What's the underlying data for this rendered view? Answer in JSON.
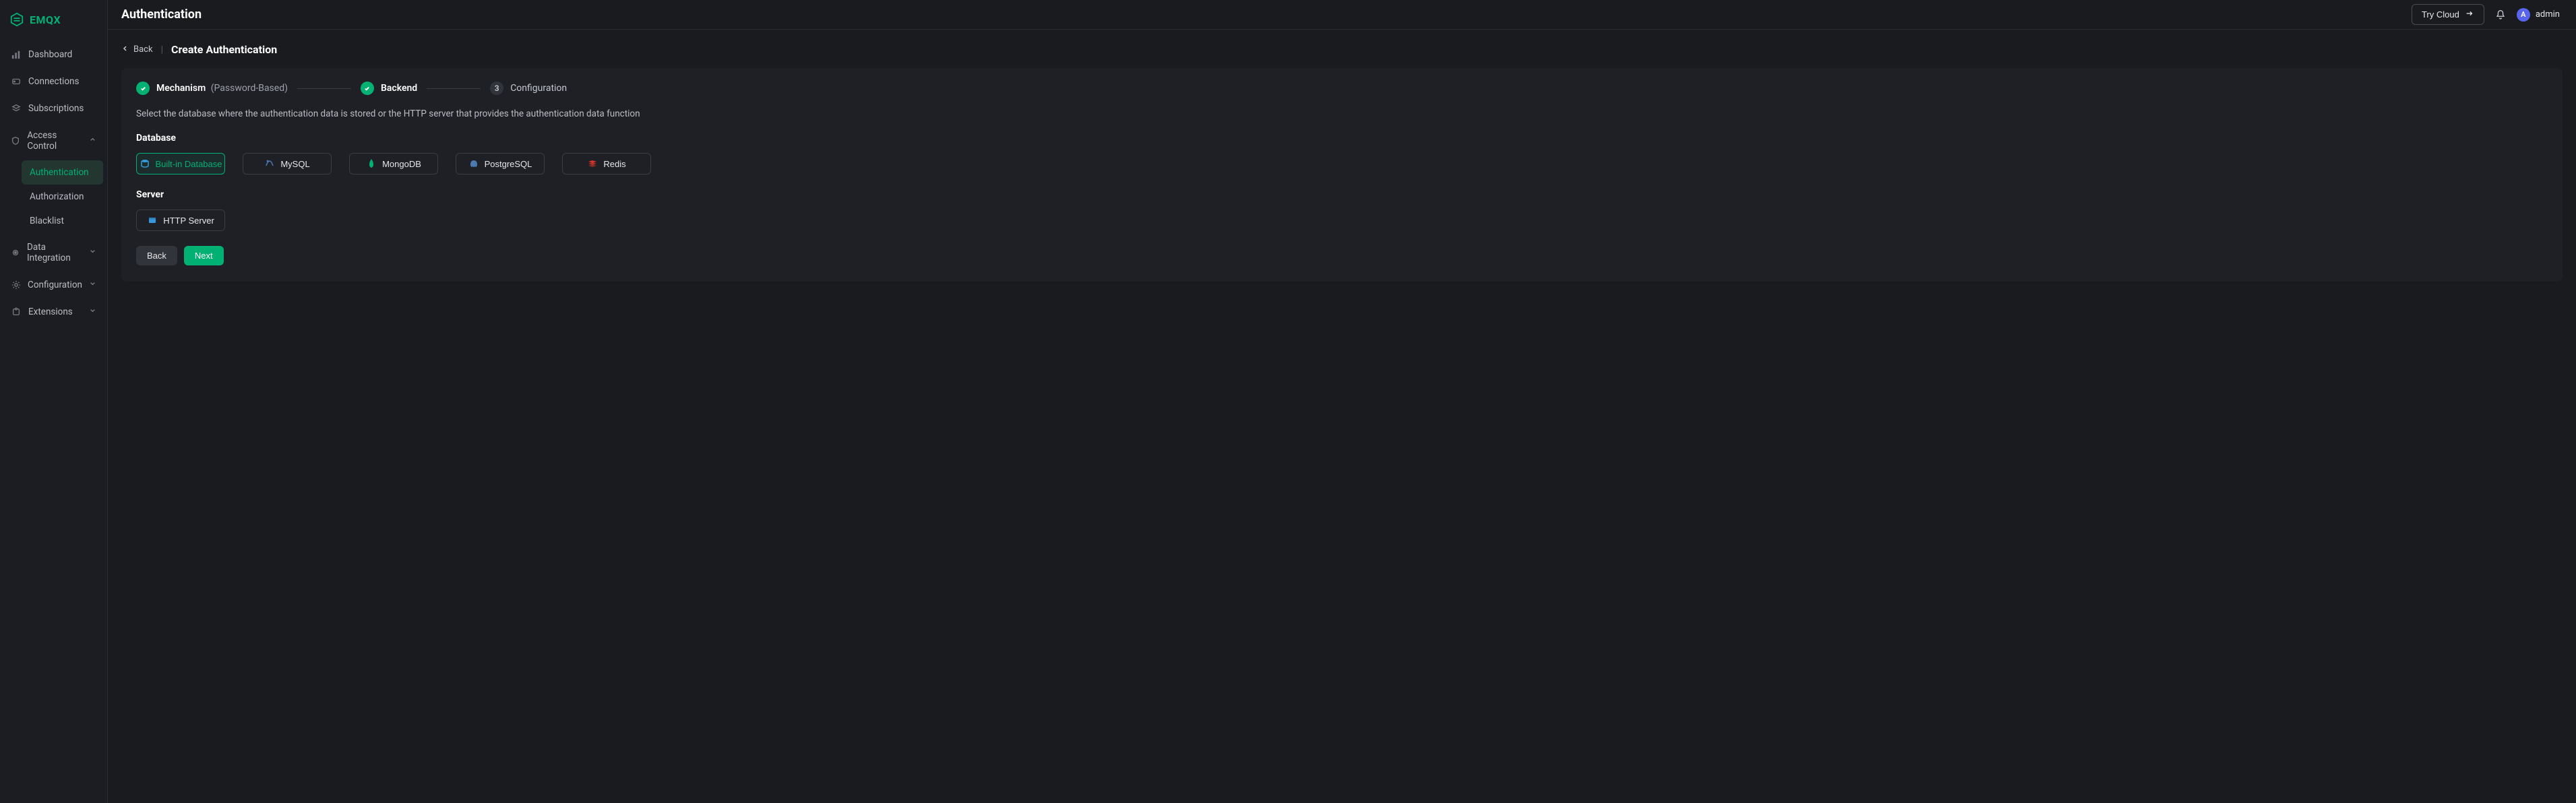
{
  "brand": {
    "name": "EMQX"
  },
  "sidebar": {
    "items": [
      {
        "label": "Dashboard",
        "icon": "chart-bar-icon"
      },
      {
        "label": "Connections",
        "icon": "link-icon"
      },
      {
        "label": "Subscriptions",
        "icon": "layers-icon"
      },
      {
        "label": "Access Control",
        "icon": "shield-icon",
        "expanded": true,
        "children": [
          {
            "label": "Authentication",
            "active": true
          },
          {
            "label": "Authorization"
          },
          {
            "label": "Blacklist"
          }
        ]
      },
      {
        "label": "Data Integration",
        "icon": "gear-icon",
        "collapsible": true
      },
      {
        "label": "Configuration",
        "icon": "cog-icon",
        "collapsible": true
      },
      {
        "label": "Extensions",
        "icon": "puzzle-icon",
        "collapsible": true
      }
    ]
  },
  "topbar": {
    "title": "Authentication",
    "try_cloud_label": "Try Cloud",
    "user": {
      "name": "admin",
      "initial": "A"
    }
  },
  "breadcrumb": {
    "back_label": "Back",
    "title": "Create Authentication"
  },
  "steps": [
    {
      "label": "Mechanism",
      "note": "(Password-Based)",
      "status": "done"
    },
    {
      "label": "Backend",
      "status": "done"
    },
    {
      "label": "Configuration",
      "status": "pending",
      "num": "3"
    }
  ],
  "helper_text": "Select the database where the authentication data is stored or the HTTP server that provides the authentication data function",
  "sections": {
    "database": {
      "title": "Database",
      "options": [
        {
          "label": "Built-in Database",
          "icon_color": "#3498db",
          "active": true
        },
        {
          "label": "MySQL",
          "icon_color": "#3498db"
        },
        {
          "label": "MongoDB",
          "icon_color": "#00b173"
        },
        {
          "label": "PostgreSQL",
          "icon_color": "#4a7ab0"
        },
        {
          "label": "Redis",
          "icon_color": "#d4342a"
        }
      ]
    },
    "server": {
      "title": "Server",
      "options": [
        {
          "label": "HTTP Server",
          "icon_color": "#3498db"
        }
      ]
    }
  },
  "actions": {
    "back": "Back",
    "next": "Next"
  }
}
